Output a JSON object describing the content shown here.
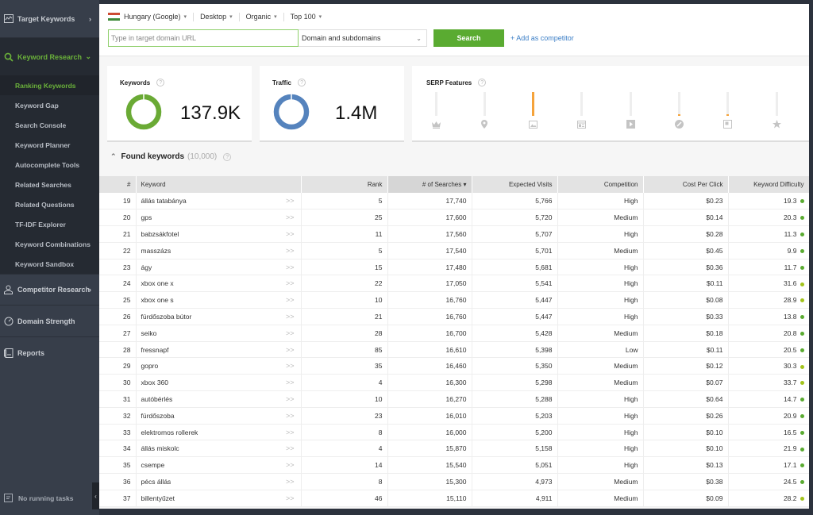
{
  "sidebar": {
    "sections": [
      {
        "label": "Target Keywords",
        "icon": "chart-line-icon",
        "expanded": false
      },
      {
        "label": "Keyword Research",
        "icon": "search-icon",
        "expanded": true,
        "items": [
          {
            "label": "Ranking Keywords",
            "active": true
          },
          {
            "label": "Keyword Gap"
          },
          {
            "label": "Search Console"
          },
          {
            "label": "Keyword Planner"
          },
          {
            "label": "Autocomplete Tools"
          },
          {
            "label": "Related Searches"
          },
          {
            "label": "Related Questions"
          },
          {
            "label": "TF-IDF Explorer"
          },
          {
            "label": "Keyword Combinations"
          },
          {
            "label": "Keyword Sandbox"
          }
        ]
      },
      {
        "label": "Competitor Research",
        "icon": "user-icon",
        "expanded": false
      },
      {
        "label": "Domain Strength",
        "icon": "gauge-icon"
      },
      {
        "label": "Reports",
        "icon": "report-icon"
      }
    ],
    "tasks_label": "No running tasks"
  },
  "filters": {
    "country": "Hungary (Google)",
    "device": "Desktop",
    "type": "Organic",
    "range": "Top 100"
  },
  "search": {
    "placeholder": "Type in target domain URL",
    "value": "",
    "scope": "Domain and subdomains",
    "button": "Search",
    "add_competitor": "+ Add as competitor"
  },
  "cards": {
    "keywords": {
      "title": "Keywords",
      "value": "137.9K",
      "color": "#6aaa35"
    },
    "traffic": {
      "title": "Traffic",
      "value": "1.4M",
      "color": "#5583bd"
    },
    "serp": {
      "title": "SERP Features",
      "features": [
        {
          "name": "featured-snippet",
          "icon": "crown-icon",
          "level": 0
        },
        {
          "name": "local-pack",
          "icon": "map-pin-icon",
          "level": 0
        },
        {
          "name": "images",
          "icon": "image-icon",
          "level": 1.0
        },
        {
          "name": "top-stories",
          "icon": "news-icon",
          "level": 0
        },
        {
          "name": "videos",
          "icon": "play-icon",
          "level": 0
        },
        {
          "name": "sitelinks",
          "icon": "link-icon",
          "level": 0.08
        },
        {
          "name": "knowledge-panel",
          "icon": "panel-icon",
          "level": 0.08
        },
        {
          "name": "reviews",
          "icon": "star-icon",
          "level": 0
        }
      ]
    }
  },
  "found": {
    "title": "Found keywords",
    "count": "(10,000)"
  },
  "table": {
    "columns": [
      "#",
      "Keyword",
      "Rank",
      "# of Searches",
      "Expected Visits",
      "Competition",
      "Cost Per Click",
      "Keyword Difficulty"
    ],
    "sort_indicator": "▾",
    "rows": [
      {
        "n": "19",
        "kw": "állás tatabánya",
        "rank": "5",
        "searches": "17,740",
        "visits": "5,766",
        "comp": "High",
        "cpc": "$0.23",
        "kd": "19.3",
        "kd_color": "#5aab31"
      },
      {
        "n": "20",
        "kw": "gps",
        "rank": "25",
        "searches": "17,600",
        "visits": "5,720",
        "comp": "Medium",
        "cpc": "$0.14",
        "kd": "20.3",
        "kd_color": "#5aab31"
      },
      {
        "n": "21",
        "kw": "babzsákfotel",
        "rank": "11",
        "searches": "17,560",
        "visits": "5,707",
        "comp": "High",
        "cpc": "$0.28",
        "kd": "11.3",
        "kd_color": "#5aab31"
      },
      {
        "n": "22",
        "kw": "masszázs",
        "rank": "5",
        "searches": "17,540",
        "visits": "5,701",
        "comp": "Medium",
        "cpc": "$0.45",
        "kd": "9.9",
        "kd_color": "#5aab31"
      },
      {
        "n": "23",
        "kw": "ágy",
        "rank": "15",
        "searches": "17,480",
        "visits": "5,681",
        "comp": "High",
        "cpc": "$0.36",
        "kd": "11.7",
        "kd_color": "#5aab31"
      },
      {
        "n": "24",
        "kw": "xbox one x",
        "rank": "22",
        "searches": "17,050",
        "visits": "5,541",
        "comp": "High",
        "cpc": "$0.11",
        "kd": "31.6",
        "kd_color": "#a3c41c"
      },
      {
        "n": "25",
        "kw": "xbox one s",
        "rank": "10",
        "searches": "16,760",
        "visits": "5,447",
        "comp": "High",
        "cpc": "$0.08",
        "kd": "28.9",
        "kd_color": "#a3c41c"
      },
      {
        "n": "26",
        "kw": "fürdőszoba bútor",
        "rank": "21",
        "searches": "16,760",
        "visits": "5,447",
        "comp": "High",
        "cpc": "$0.33",
        "kd": "13.8",
        "kd_color": "#5aab31"
      },
      {
        "n": "27",
        "kw": "seiko",
        "rank": "28",
        "searches": "16,700",
        "visits": "5,428",
        "comp": "Medium",
        "cpc": "$0.18",
        "kd": "20.8",
        "kd_color": "#5aab31"
      },
      {
        "n": "28",
        "kw": "fressnapf",
        "rank": "85",
        "searches": "16,610",
        "visits": "5,398",
        "comp": "Low",
        "cpc": "$0.11",
        "kd": "20.5",
        "kd_color": "#5aab31"
      },
      {
        "n": "29",
        "kw": "gopro",
        "rank": "35",
        "searches": "16,460",
        "visits": "5,350",
        "comp": "Medium",
        "cpc": "$0.12",
        "kd": "30.3",
        "kd_color": "#a3c41c"
      },
      {
        "n": "30",
        "kw": "xbox 360",
        "rank": "4",
        "searches": "16,300",
        "visits": "5,298",
        "comp": "Medium",
        "cpc": "$0.07",
        "kd": "33.7",
        "kd_color": "#a3c41c"
      },
      {
        "n": "31",
        "kw": "autóbérlés",
        "rank": "10",
        "searches": "16,270",
        "visits": "5,288",
        "comp": "High",
        "cpc": "$0.64",
        "kd": "14.7",
        "kd_color": "#5aab31"
      },
      {
        "n": "32",
        "kw": "fürdőszoba",
        "rank": "23",
        "searches": "16,010",
        "visits": "5,203",
        "comp": "High",
        "cpc": "$0.26",
        "kd": "20.9",
        "kd_color": "#5aab31"
      },
      {
        "n": "33",
        "kw": "elektromos rollerek",
        "rank": "8",
        "searches": "16,000",
        "visits": "5,200",
        "comp": "High",
        "cpc": "$0.10",
        "kd": "16.5",
        "kd_color": "#5aab31"
      },
      {
        "n": "34",
        "kw": "állás miskolc",
        "rank": "4",
        "searches": "15,870",
        "visits": "5,158",
        "comp": "High",
        "cpc": "$0.10",
        "kd": "21.9",
        "kd_color": "#5aab31"
      },
      {
        "n": "35",
        "kw": "csempe",
        "rank": "14",
        "searches": "15,540",
        "visits": "5,051",
        "comp": "High",
        "cpc": "$0.13",
        "kd": "17.1",
        "kd_color": "#5aab31"
      },
      {
        "n": "36",
        "kw": "pécs állás",
        "rank": "8",
        "searches": "15,300",
        "visits": "4,973",
        "comp": "Medium",
        "cpc": "$0.38",
        "kd": "24.5",
        "kd_color": "#5aab31"
      },
      {
        "n": "37",
        "kw": "billentyűzet",
        "rank": "46",
        "searches": "15,110",
        "visits": "4,911",
        "comp": "Medium",
        "cpc": "$0.09",
        "kd": "28.2",
        "kd_color": "#a3c41c"
      }
    ]
  }
}
